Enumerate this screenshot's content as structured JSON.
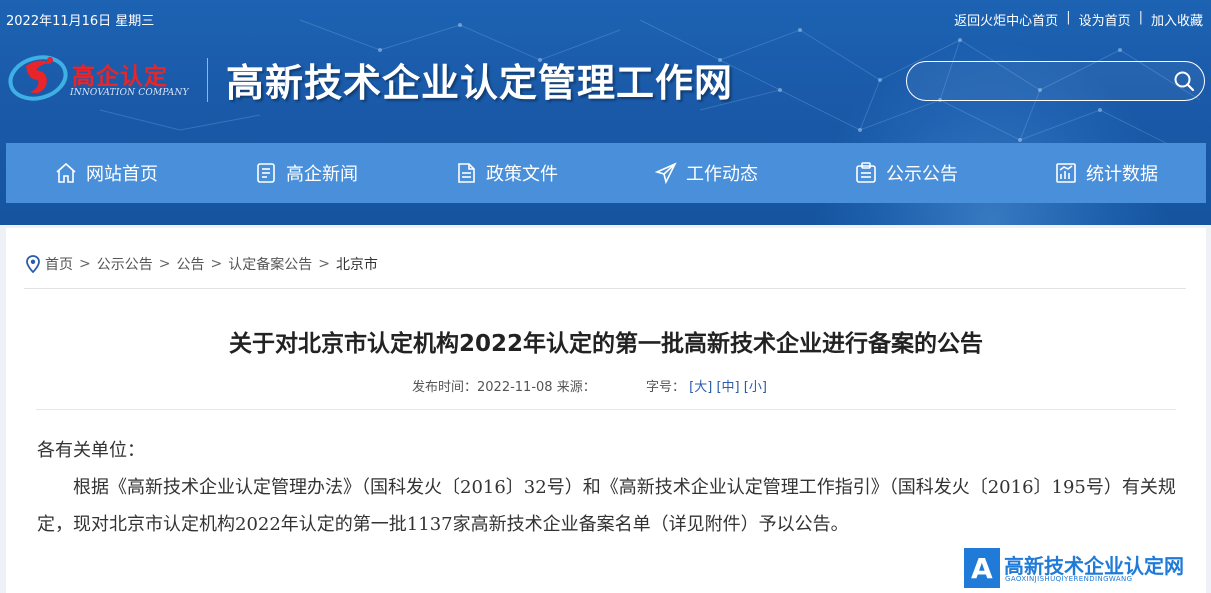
{
  "topbar": {
    "date": "2022年11月16日 星期三",
    "links": [
      "返回火炬中心首页",
      "设为首页",
      "加入收藏"
    ],
    "separator": "|"
  },
  "logo": {
    "brand": "高企认定",
    "brand_en": "INNOVATION COMPANY"
  },
  "site_title": "高新技术企业认定管理工作网",
  "search": {
    "placeholder": "",
    "value": ""
  },
  "nav": {
    "items": [
      {
        "label": "网站首页",
        "icon": "home-icon"
      },
      {
        "label": "高企新闻",
        "icon": "news-icon"
      },
      {
        "label": "政策文件",
        "icon": "document-icon"
      },
      {
        "label": "工作动态",
        "icon": "send-icon"
      },
      {
        "label": "公示公告",
        "icon": "notice-icon"
      },
      {
        "label": "统计数据",
        "icon": "chart-icon"
      }
    ]
  },
  "breadcrumb": {
    "items": [
      "首页",
      "公示公告",
      "公告",
      "认定备案公告",
      "北京市"
    ],
    "separator": ">"
  },
  "article": {
    "title": "关于对北京市认定机构2022年认定的第一批高新技术企业进行备案的公告",
    "meta": {
      "published_label": "发布时间：",
      "published": "2022-11-08",
      "source_label": "来源：",
      "font_label": "字号：",
      "font_large": "[大]",
      "font_medium": "[中]",
      "font_small": "[小]"
    },
    "salutation": "各有关单位：",
    "paragraph": "根据《高新技术企业认定管理办法》（国科发火〔2016〕32号）和《高新技术企业认定管理工作指引》（国科发火〔2016〕195号）有关规定，现对北京市认定机构2022年认定的第一批1137家高新技术企业备案名单（详见附件）予以公告。"
  },
  "watermark": {
    "letter": "A",
    "text": "高新技术企业认定网",
    "pinyin": "GAOXINJISHUQIYERENDINGWANG"
  },
  "colors": {
    "header_bg": "#1a5aa9",
    "nav_bg": "#4a8fd9",
    "brand_red": "#e7252a",
    "link_blue": "#2a5ca8",
    "watermark_blue": "#1f7ad8"
  }
}
